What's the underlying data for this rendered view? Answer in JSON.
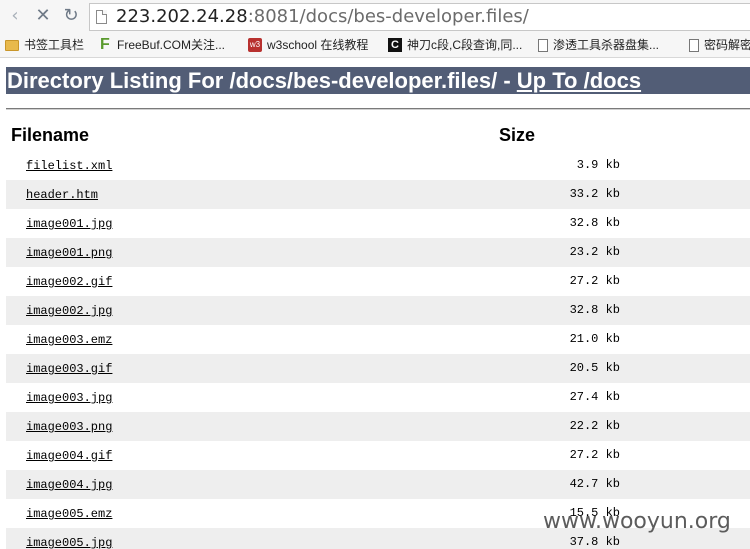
{
  "browser": {
    "url_host": "223.202.24.28",
    "url_rest": ":8081/docs/bes-developer.files/",
    "nav": {
      "back": "‹",
      "stop": "✕",
      "reload": "↻"
    }
  },
  "bookmarks": [
    {
      "icon": "folder-icon",
      "label": "书签工具栏"
    },
    {
      "icon": "freebuf-icon",
      "label": "FreeBuf.COM关注..."
    },
    {
      "icon": "w3school-icon",
      "label": "w3school 在线教程"
    },
    {
      "icon": "c-duan-icon",
      "label": "神刀c段,C段查询,同..."
    },
    {
      "icon": "page-icon",
      "label": "渗透工具杀器盘集..."
    },
    {
      "icon": "page-icon",
      "label": "密码解密"
    }
  ],
  "page": {
    "title_prefix": "Directory Listing For /docs/bes-developer.files/ - ",
    "title_link": "Up To /docs",
    "col_filename": "Filename",
    "col_size": "Size",
    "files": [
      {
        "name": "filelist.xml",
        "size": "3.9 kb"
      },
      {
        "name": "header.htm",
        "size": "33.2 kb"
      },
      {
        "name": "image001.jpg",
        "size": "32.8 kb"
      },
      {
        "name": "image001.png",
        "size": "23.2 kb"
      },
      {
        "name": "image002.gif",
        "size": "27.2 kb"
      },
      {
        "name": "image002.jpg",
        "size": "32.8 kb"
      },
      {
        "name": "image003.emz",
        "size": "21.0 kb"
      },
      {
        "name": "image003.gif",
        "size": "20.5 kb"
      },
      {
        "name": "image003.jpg",
        "size": "27.4 kb"
      },
      {
        "name": "image003.png",
        "size": "22.2 kb"
      },
      {
        "name": "image004.gif",
        "size": "27.2 kb"
      },
      {
        "name": "image004.jpg",
        "size": "42.7 kb"
      },
      {
        "name": "image005.emz",
        "size": "15.5 kb"
      },
      {
        "name": "image005.jpg",
        "size": "37.8 kb"
      }
    ]
  },
  "watermark": "www.wooyun.org",
  "colors": {
    "title_bar": "#525d76",
    "row_alt": "#eeeeee"
  }
}
